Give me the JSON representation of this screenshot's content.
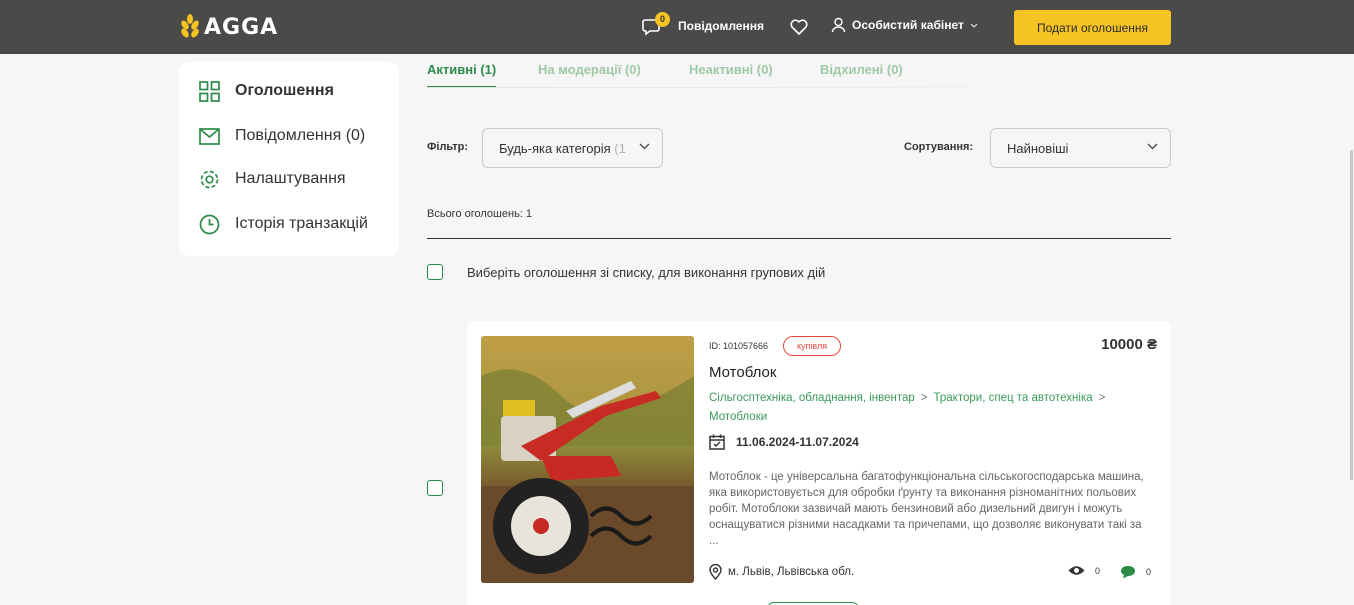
{
  "header": {
    "logo_text": "AGGA",
    "messages_label": "Повідомлення",
    "messages_count": "0",
    "cabinet_label": "Особистий кабінет",
    "post_button": "Подати оголошення",
    "accent_color": "#f5c423",
    "bg_color": "#4a4a48"
  },
  "sidebar": {
    "items": [
      {
        "label": "Оголошення",
        "icon": "grid-icon",
        "active": true
      },
      {
        "label": "Повідомлення (0)",
        "icon": "envelope-icon",
        "active": false
      },
      {
        "label": "Налаштування",
        "icon": "gear-icon",
        "active": false
      },
      {
        "label": "Історія транзакцій",
        "icon": "clock-icon",
        "active": false
      }
    ]
  },
  "tabs": [
    {
      "label": "Активні (1)",
      "active": true
    },
    {
      "label": "На модерації (0)",
      "active": false
    },
    {
      "label": "Неактивні (0)",
      "active": false
    },
    {
      "label": "Відхилені (0)",
      "active": false
    }
  ],
  "filter": {
    "label": "Фільтр:",
    "value": "Будь-яка категорія",
    "value_fade": "(1"
  },
  "sort": {
    "label": "Сортування:",
    "value": "Найновіші"
  },
  "total_text": "Всього оголошень: 1",
  "bulk_label": "Виберіть оголошення зі списку, для виконання групових дій",
  "listing": {
    "id_text": "ID: 101057666",
    "tag": "купівля",
    "price": "10000 ₴",
    "title": "Мотоблок",
    "crumbs": [
      "Сільгосптехніка, обладнання, інвентар",
      "Трактори, спец та автотехніка",
      "Мотоблоки"
    ],
    "crumb_separator": ">",
    "dates": "11.06.2024-11.07.2024",
    "description": "Мотоблок - це універсальна багатофункціональна сільськогосподарська машина, яка використовується для обробки ґрунту та виконання різноманітних польових робіт. Мотоблоки зазвичай мають бензиновий або дизельний двигун і можуть оснащуватися різними насадками та причепами, що дозволяє виконувати такі за ...",
    "location": "м. Львів, Львівська обл.",
    "views": "0",
    "comments": "0"
  },
  "colors": {
    "green": "#2d8b4a",
    "green_light": "#9fc8a6",
    "red_tag": "#e04a3b"
  }
}
